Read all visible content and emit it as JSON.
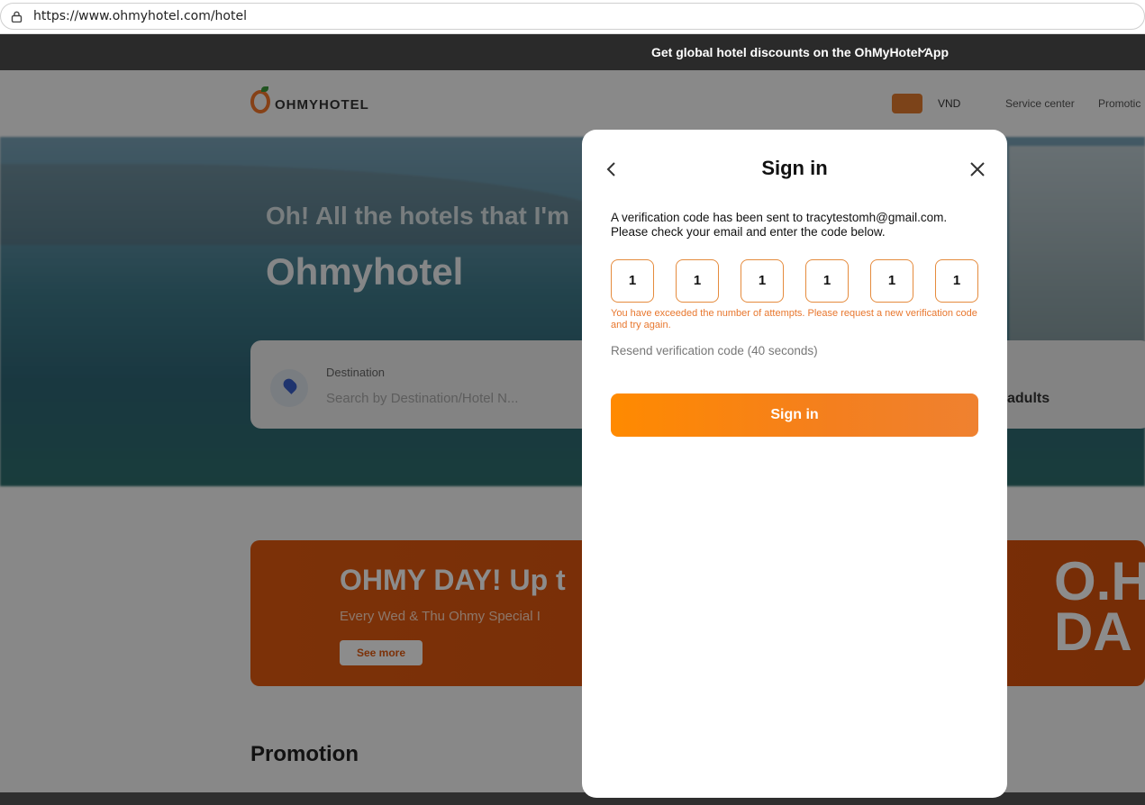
{
  "browser": {
    "url": "https://www.ohmyhotel.com/hotel"
  },
  "promo_bar": {
    "text": "Get global hotel discounts on the OhMyHotel App"
  },
  "header": {
    "logo_text": "OHMYHOTEL",
    "currency": "VND",
    "service_center": "Service center",
    "promotion_link": "Promotic"
  },
  "hero": {
    "line1": "Oh! All the hotels that I'm",
    "line2": "Ohmyhotel"
  },
  "search": {
    "destination_label": "Destination",
    "destination_placeholder": "Search by Destination/Hotel N...",
    "guests": "adults"
  },
  "banner": {
    "title": "OHMY DAY! Up t",
    "subtitle": "Every Wed & Thu Ohmy Special I",
    "button": "See more",
    "big": "O.H\nDA"
  },
  "section": {
    "promotion_heading": "Promotion"
  },
  "modal": {
    "title": "Sign in",
    "message": "A verification code has been sent to tracytestomh@gmail.com. Please check your email and enter the code below.",
    "codes": [
      "1",
      "1",
      "1",
      "1",
      "1",
      "1"
    ],
    "error": "You have exceeded the number of attempts. Please request a new verification code and try again.",
    "resend": "Resend verification code (40  seconds)",
    "submit": "Sign in"
  },
  "colors": {
    "accent": "#f47f1e",
    "error": "#e8772e",
    "code_border": "#e58b3d"
  }
}
